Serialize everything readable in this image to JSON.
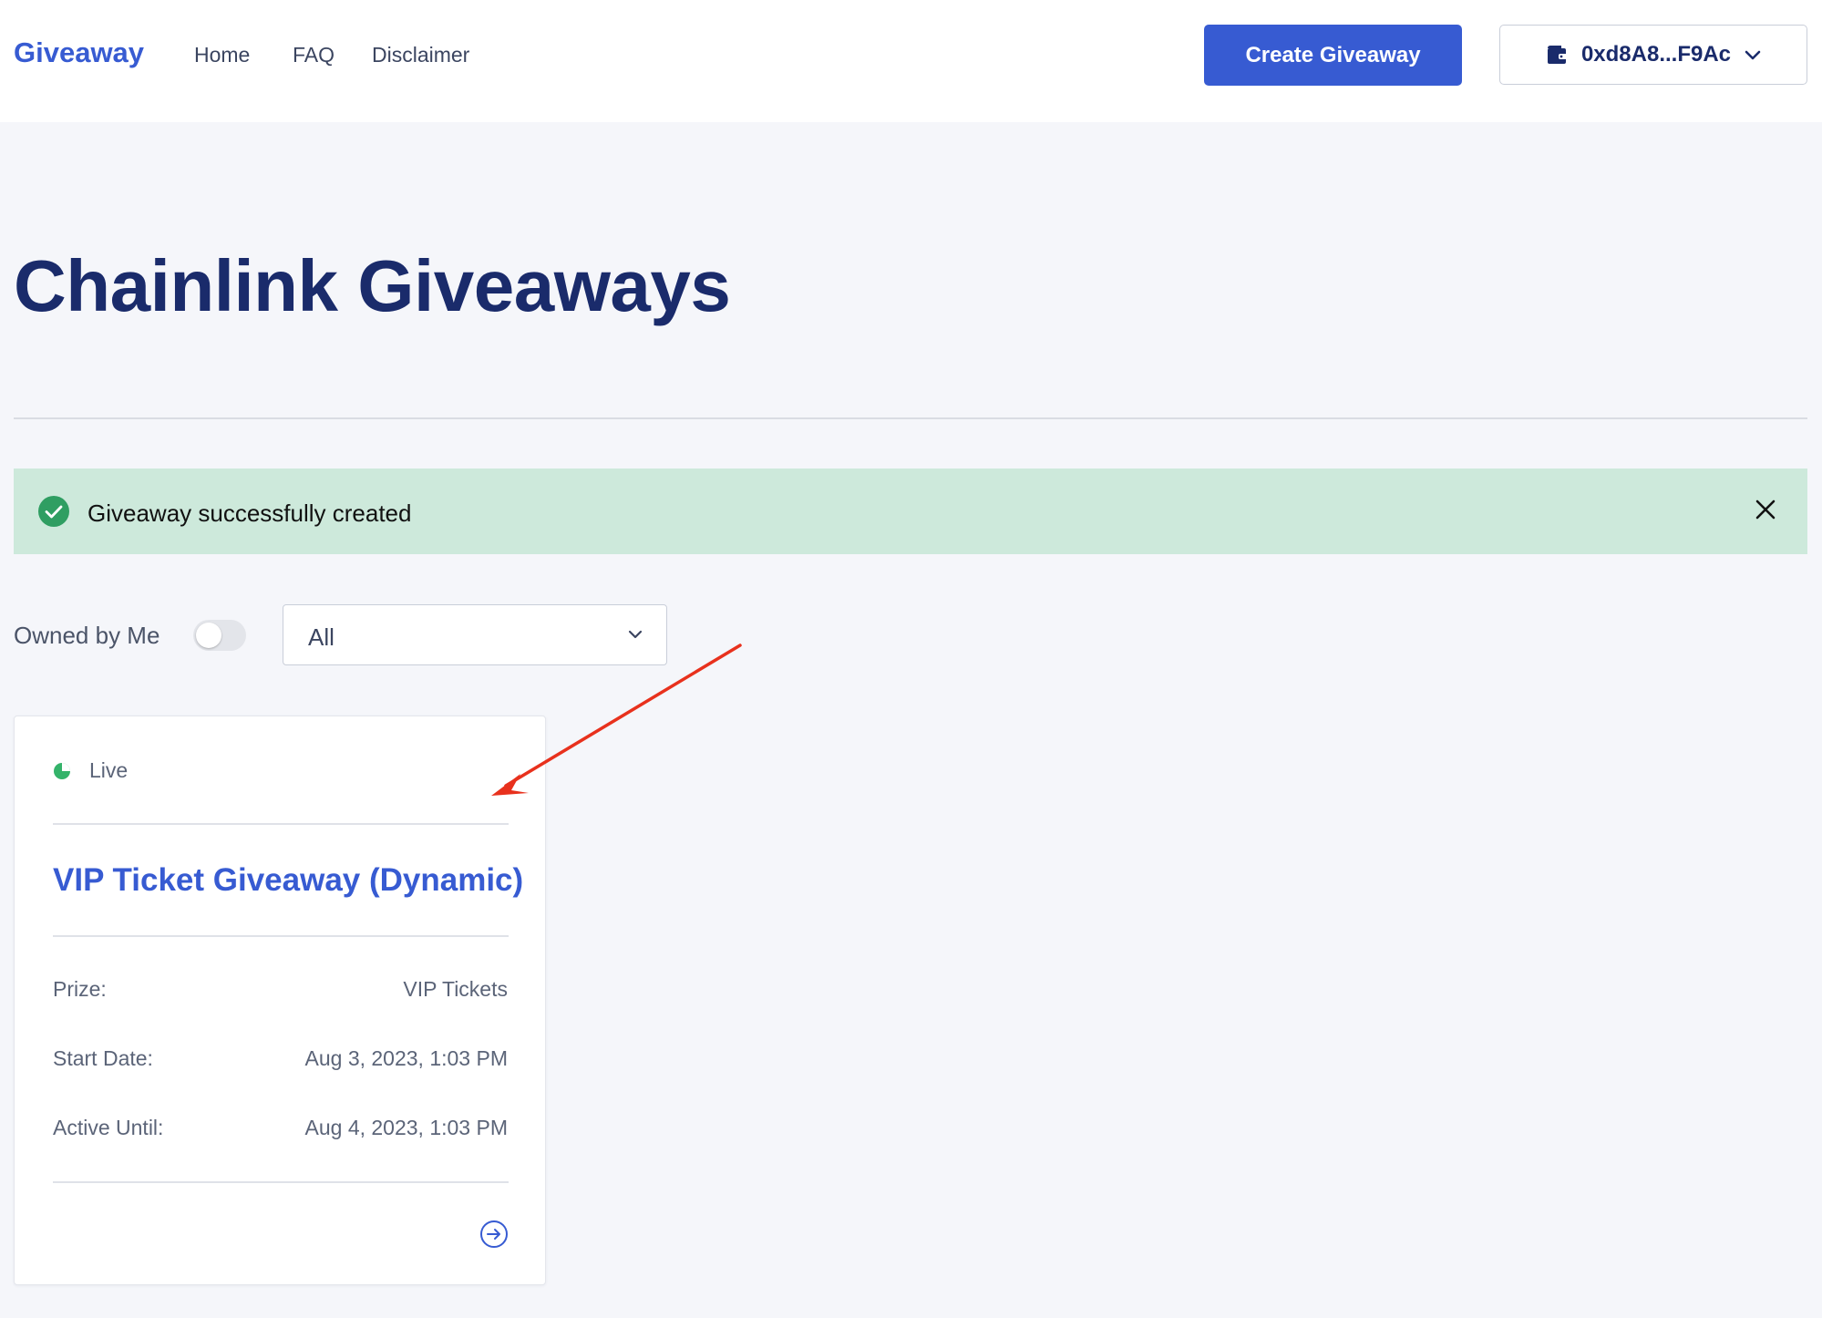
{
  "header": {
    "brand": "Giveaway",
    "nav": [
      {
        "label": "Home"
      },
      {
        "label": "FAQ"
      },
      {
        "label": "Disclaimer"
      }
    ],
    "create_button": "Create Giveaway",
    "wallet": {
      "address": "0xd8A8...F9Ac",
      "icon": "wallet-icon"
    }
  },
  "main": {
    "title": "Chainlink Giveaways",
    "alert": {
      "message": "Giveaway successfully created",
      "status_color": "#2f9e62",
      "background": "#cde9db"
    },
    "filters": {
      "owned_by_me_label": "Owned by Me",
      "owned_by_me_enabled": false,
      "status_select_value": "All"
    },
    "cards": [
      {
        "status": "Live",
        "status_color": "#34b36a",
        "title": "VIP Ticket Giveaway (Dynamic)",
        "rows": [
          {
            "label": "Prize:",
            "value": "VIP Tickets"
          },
          {
            "label": "Start Date:",
            "value": "Aug 3, 2023, 1:03 PM"
          },
          {
            "label": "Active Until:",
            "value": "Aug 4, 2023, 1:03 PM"
          }
        ]
      }
    ]
  },
  "colors": {
    "accent": "#375bd2",
    "title": "#1a2b6b",
    "page_background": "#f5f6fa",
    "annotation_arrow": "#e8311d"
  }
}
